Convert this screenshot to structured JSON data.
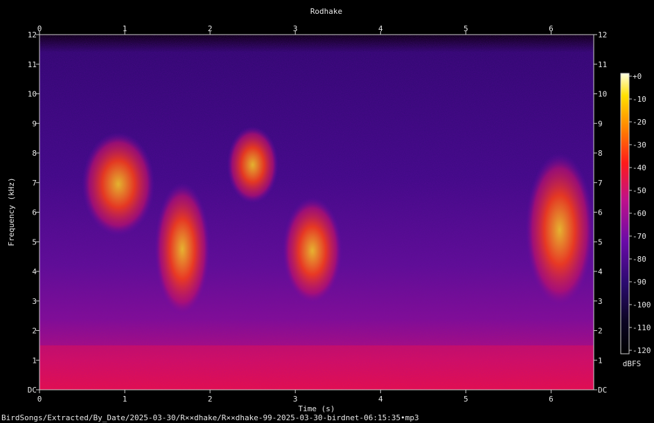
{
  "chart_data": {
    "type": "heatmap",
    "title": "Rodhake",
    "xlabel": "Time (s)",
    "ylabel": "Frequency (kHz)",
    "xlim": [
      0,
      6.5
    ],
    "ylim": [
      0,
      12
    ],
    "x_ticks": [
      "0",
      "1",
      "2",
      "3",
      "4",
      "5",
      "6"
    ],
    "y_ticks": [
      "DC",
      "1",
      "2",
      "3",
      "4",
      "5",
      "6",
      "7",
      "8",
      "9",
      "10",
      "11",
      "12"
    ],
    "colorbar": {
      "label": "dBFS",
      "ticks": [
        "+0",
        "-10",
        "-20",
        "-30",
        "-40",
        "-50",
        "-60",
        "-70",
        "-80",
        "-90",
        "-100",
        "-110",
        "-120"
      ],
      "range": [
        -120,
        0
      ]
    },
    "calls": [
      {
        "t_start": 0.5,
        "t_end": 1.35,
        "f_low": 5.2,
        "f_high": 8.7,
        "level": -35
      },
      {
        "t_start": 1.35,
        "t_end": 2.0,
        "f_low": 2.5,
        "f_high": 7.0,
        "level": -40
      },
      {
        "t_start": 2.2,
        "t_end": 2.8,
        "f_low": 6.3,
        "f_high": 8.9,
        "level": -35
      },
      {
        "t_start": 2.85,
        "t_end": 3.55,
        "f_low": 2.9,
        "f_high": 6.5,
        "level": -40
      },
      {
        "t_start": 5.7,
        "t_end": 6.5,
        "f_low": 2.8,
        "f_high": 8.0,
        "level": -40
      }
    ]
  },
  "footer": {
    "file_path": "BirdSongs/Extracted/By_Date/2025-03-30/R××dhake/R××dhake-99-2025-03-30-birdnet-06:15:35•mp3"
  }
}
